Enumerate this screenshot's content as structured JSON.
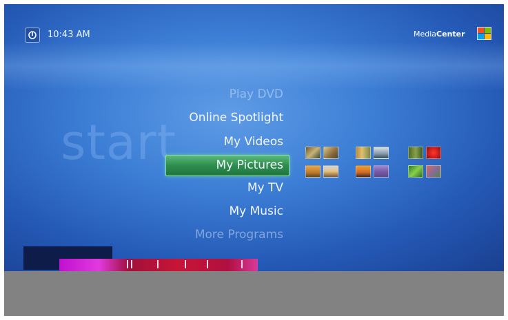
{
  "header": {
    "time": "10:43 AM",
    "brand_light": "Media",
    "brand_bold": "Center"
  },
  "start_watermark": "start",
  "menu": {
    "items": [
      {
        "label": "Play DVD",
        "state": "faded"
      },
      {
        "label": "Online Spotlight",
        "state": "normal"
      },
      {
        "label": "My Videos",
        "state": "normal"
      },
      {
        "label": "My Pictures",
        "state": "selected"
      },
      {
        "label": "My TV",
        "state": "normal"
      },
      {
        "label": "My Music",
        "state": "normal"
      },
      {
        "label": "More Programs",
        "state": "faded"
      }
    ]
  },
  "colors": {
    "background_blue": "#2f6ccb",
    "selected_green": "#2e8e4e",
    "gray_bar": "#828282"
  },
  "icons": {
    "power": "power-icon",
    "logo": "windows-flag-icon"
  }
}
